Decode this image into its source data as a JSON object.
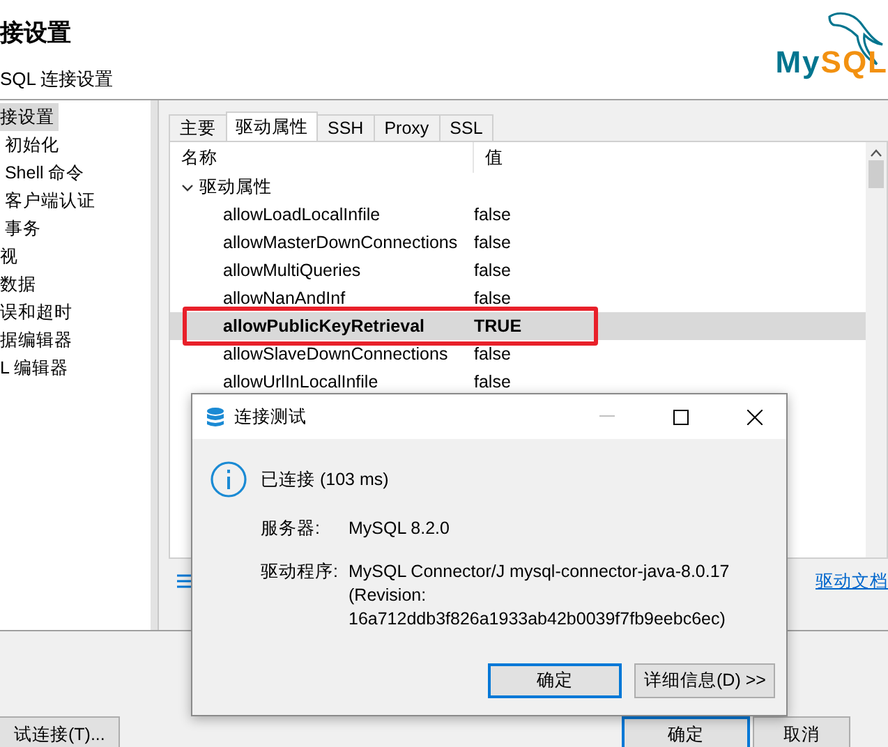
{
  "header": {
    "title": "接设置",
    "subtitle": "SQL 连接设置",
    "logo": [
      "My",
      "SQL"
    ]
  },
  "sidebar": {
    "items": [
      {
        "label": "接设置",
        "selected": true
      },
      {
        "label": " 初始化",
        "selected": false
      },
      {
        "label": " Shell 命令",
        "selected": false
      },
      {
        "label": " 客户端认证",
        "selected": false
      },
      {
        "label": " 事务",
        "selected": false
      },
      {
        "label": "视",
        "selected": false
      },
      {
        "label": "数据",
        "selected": false
      },
      {
        "label": "误和超时",
        "selected": false
      },
      {
        "label": "据编辑器",
        "selected": false
      },
      {
        "label": "L 编辑器",
        "selected": false
      }
    ]
  },
  "tabs": [
    {
      "label": "主要",
      "selected": false
    },
    {
      "label": "驱动属性",
      "selected": true
    },
    {
      "label": "SSH",
      "selected": false
    },
    {
      "label": "Proxy",
      "selected": false
    },
    {
      "label": "SSL",
      "selected": false
    }
  ],
  "table": {
    "columns": [
      "名称",
      "值"
    ],
    "group": {
      "label": "驱动属性",
      "expanded": true,
      "rows": [
        {
          "name": "allowLoadLocalInfile",
          "value": "false",
          "selected": false,
          "outlined": false
        },
        {
          "name": "allowMasterDownConnections",
          "value": "false",
          "selected": false,
          "outlined": false
        },
        {
          "name": "allowMultiQueries",
          "value": "false",
          "selected": false,
          "outlined": false
        },
        {
          "name": "allowNanAndInf",
          "value": "false",
          "selected": false,
          "outlined": false
        },
        {
          "name": "allowPublicKeyRetrieval",
          "value": "TRUE",
          "selected": true,
          "outlined": true
        },
        {
          "name": "allowSlaveDownConnections",
          "value": "false",
          "selected": false,
          "outlined": false
        },
        {
          "name": "allowUrlInLocalInfile",
          "value": "false",
          "selected": false,
          "outlined": false
        }
      ]
    }
  },
  "docs_link": "驱动文档",
  "buttons": [
    {
      "label": "试连接(T)...",
      "default": false
    },
    {
      "label": "确定",
      "default": true
    },
    {
      "label": "取消",
      "default": false
    }
  ],
  "dialog": {
    "title": "连接测试",
    "message": "已连接 (103 ms)",
    "details": [
      {
        "label": "服务器:",
        "value": "MySQL 8.2.0"
      },
      {
        "label": "驱动程序:",
        "value": "MySQL Connector/J mysql-connector-java-8.0.17 (Revision: 16a712ddb3f826a1933ab42b0039f7fb9eebc6ec)"
      }
    ],
    "buttons": [
      {
        "label": "确定",
        "default": true
      },
      {
        "label": "详细信息(D) >>",
        "default": false
      }
    ]
  }
}
